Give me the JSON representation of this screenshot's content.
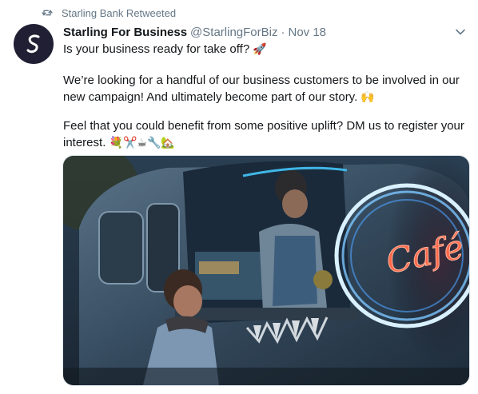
{
  "retweet": {
    "label": "Starling Bank Retweeted",
    "icon": "retweet-icon"
  },
  "tweet": {
    "avatar_icon": "starling-logo-icon",
    "display_name": "Starling For Business",
    "handle": "@StarlingForBiz",
    "separator": "·",
    "date": "Nov 18",
    "caret_icon": "chevron-down-icon",
    "line1_text": "Is your business ready for take off?",
    "line1_emoji": "🚀",
    "para2_text": "We’re looking for a handful of our business customers to be involved in our new campaign! And ultimately become part of our story.",
    "para2_emoji": "🙌",
    "para3_text": "Feel that you could benefit from some positive uplift? DM us to register your interest.",
    "para3_emoji": "💐✂️☕🔧🏡"
  },
  "media": {
    "sign_text": "Café",
    "alt_icon": "food-truck-photo"
  },
  "colors": {
    "muted": "#657786",
    "text": "#14171a",
    "avatar_bg": "#211f33"
  }
}
